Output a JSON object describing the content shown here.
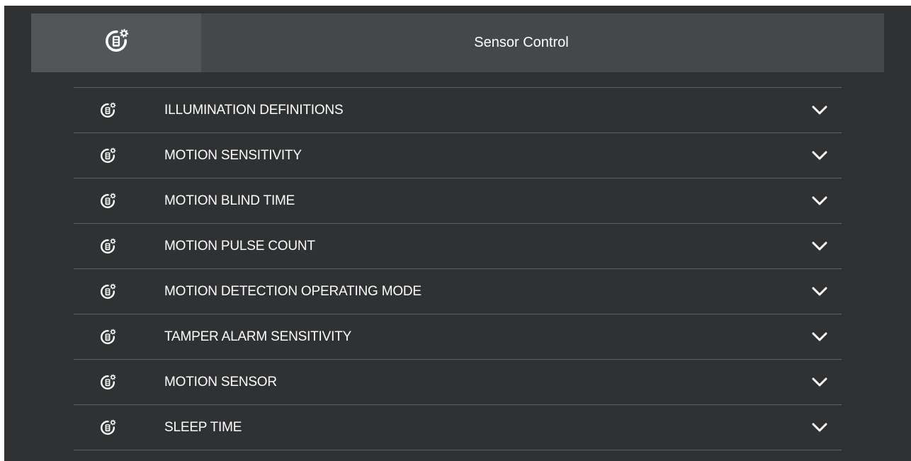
{
  "header": {
    "title": "Sensor Control",
    "icon": "sensor-gear-icon"
  },
  "colors": {
    "background": "#2f3132",
    "header": "#45484a",
    "header_icon_cell": "#535659",
    "divider": "#5e6163",
    "text": "#ffffff"
  },
  "items": [
    {
      "label": "ILLUMINATION DEFINITIONS",
      "icon": "sensor-gear-icon",
      "expand_icon": "chevron-down-icon"
    },
    {
      "label": "MOTION SENSITIVITY",
      "icon": "sensor-gear-icon",
      "expand_icon": "chevron-down-icon"
    },
    {
      "label": "MOTION BLIND TIME",
      "icon": "sensor-gear-icon",
      "expand_icon": "chevron-down-icon"
    },
    {
      "label": "MOTION PULSE COUNT",
      "icon": "sensor-gear-icon",
      "expand_icon": "chevron-down-icon"
    },
    {
      "label": "MOTION DETECTION OPERATING MODE",
      "icon": "sensor-gear-icon",
      "expand_icon": "chevron-down-icon"
    },
    {
      "label": "TAMPER ALARM SENSITIVITY",
      "icon": "sensor-gear-icon",
      "expand_icon": "chevron-down-icon"
    },
    {
      "label": "MOTION SENSOR",
      "icon": "sensor-gear-icon",
      "expand_icon": "chevron-down-icon"
    },
    {
      "label": "SLEEP TIME",
      "icon": "sensor-gear-icon",
      "expand_icon": "chevron-down-icon"
    }
  ]
}
